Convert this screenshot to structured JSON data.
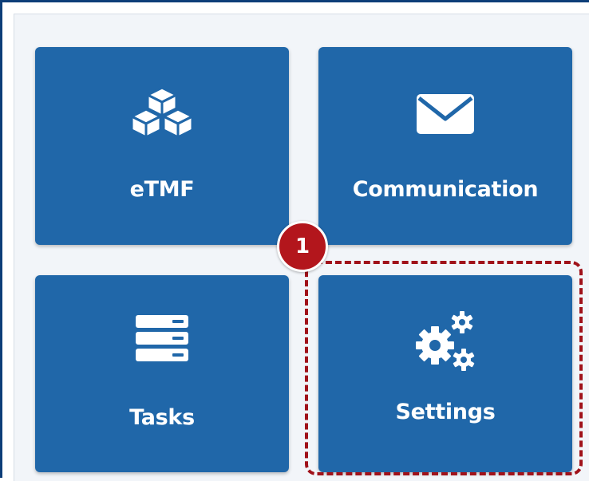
{
  "tiles": {
    "etmf": {
      "label": "eTMF",
      "icon": "cubes-icon"
    },
    "communication": {
      "label": "Communication",
      "icon": "envelope-icon"
    },
    "tasks": {
      "label": "Tasks",
      "icon": "tasks-list-icon"
    },
    "settings": {
      "label": "Settings",
      "icon": "gears-icon"
    }
  },
  "annotation": {
    "step_number": "1",
    "highlighted_tile": "settings"
  },
  "colors": {
    "tile_background": "#2067a9",
    "panel_background": "#f2f5f9",
    "frame_border": "#0d3e78",
    "annotation_red": "#b3161c"
  }
}
